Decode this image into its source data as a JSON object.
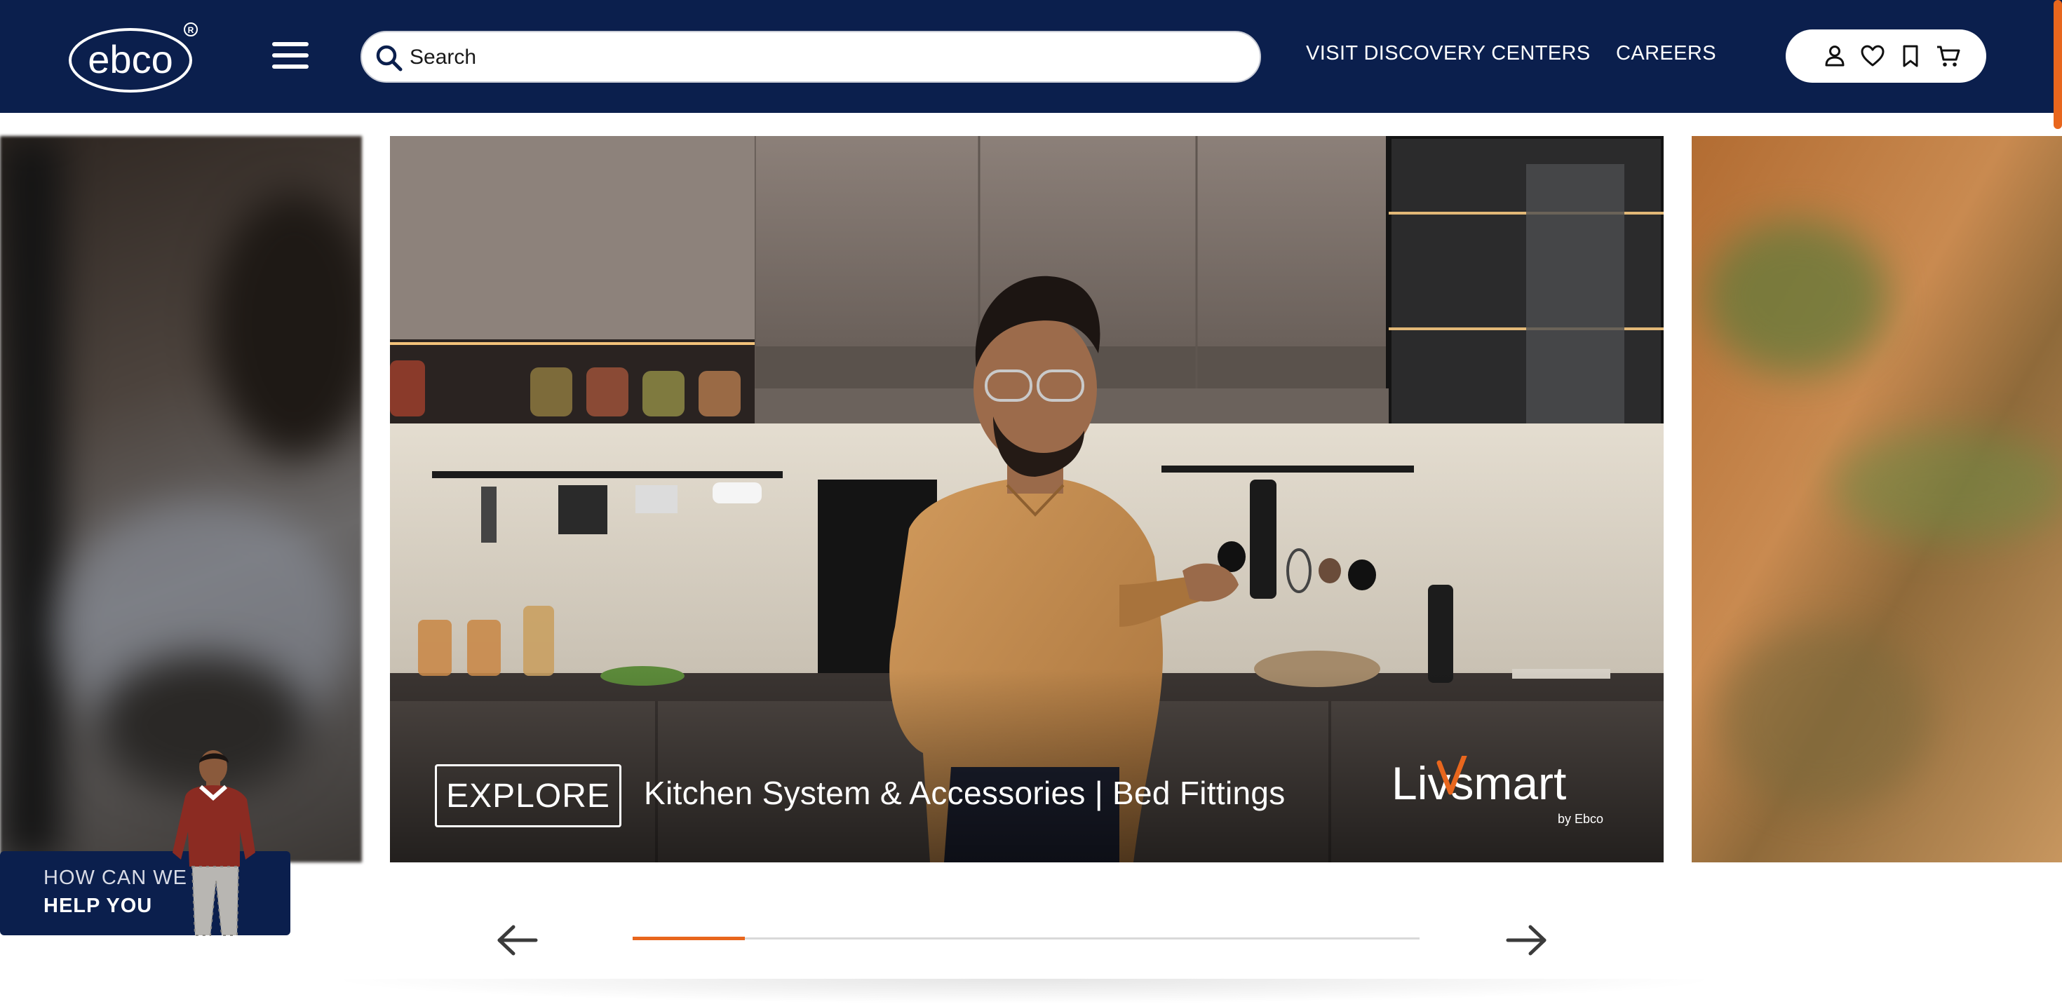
{
  "header": {
    "brand_name": "ebco",
    "registered_mark": "®",
    "search": {
      "placeholder": "Search",
      "value": ""
    },
    "nav": {
      "visit_label": "VISIT DISCOVERY CENTERS",
      "careers_label": "CAREERS"
    },
    "icons": [
      "user-icon",
      "heart-icon",
      "bookmark-icon",
      "cart-icon"
    ]
  },
  "carousel": {
    "active_slide": {
      "button_label": "EXPLORE",
      "tagline": "Kitchen System & Accessories | Bed Fittings",
      "brand_logo_text": "Livsmart",
      "brand_logo_sub": "by Ebco"
    },
    "progress_fraction": 0.143
  },
  "help_widget": {
    "line1": "HOW CAN WE",
    "line2": "HELP YOU"
  },
  "colors": {
    "navy": "#0b1f4d",
    "accent_orange": "#e8661d",
    "white": "#ffffff"
  }
}
